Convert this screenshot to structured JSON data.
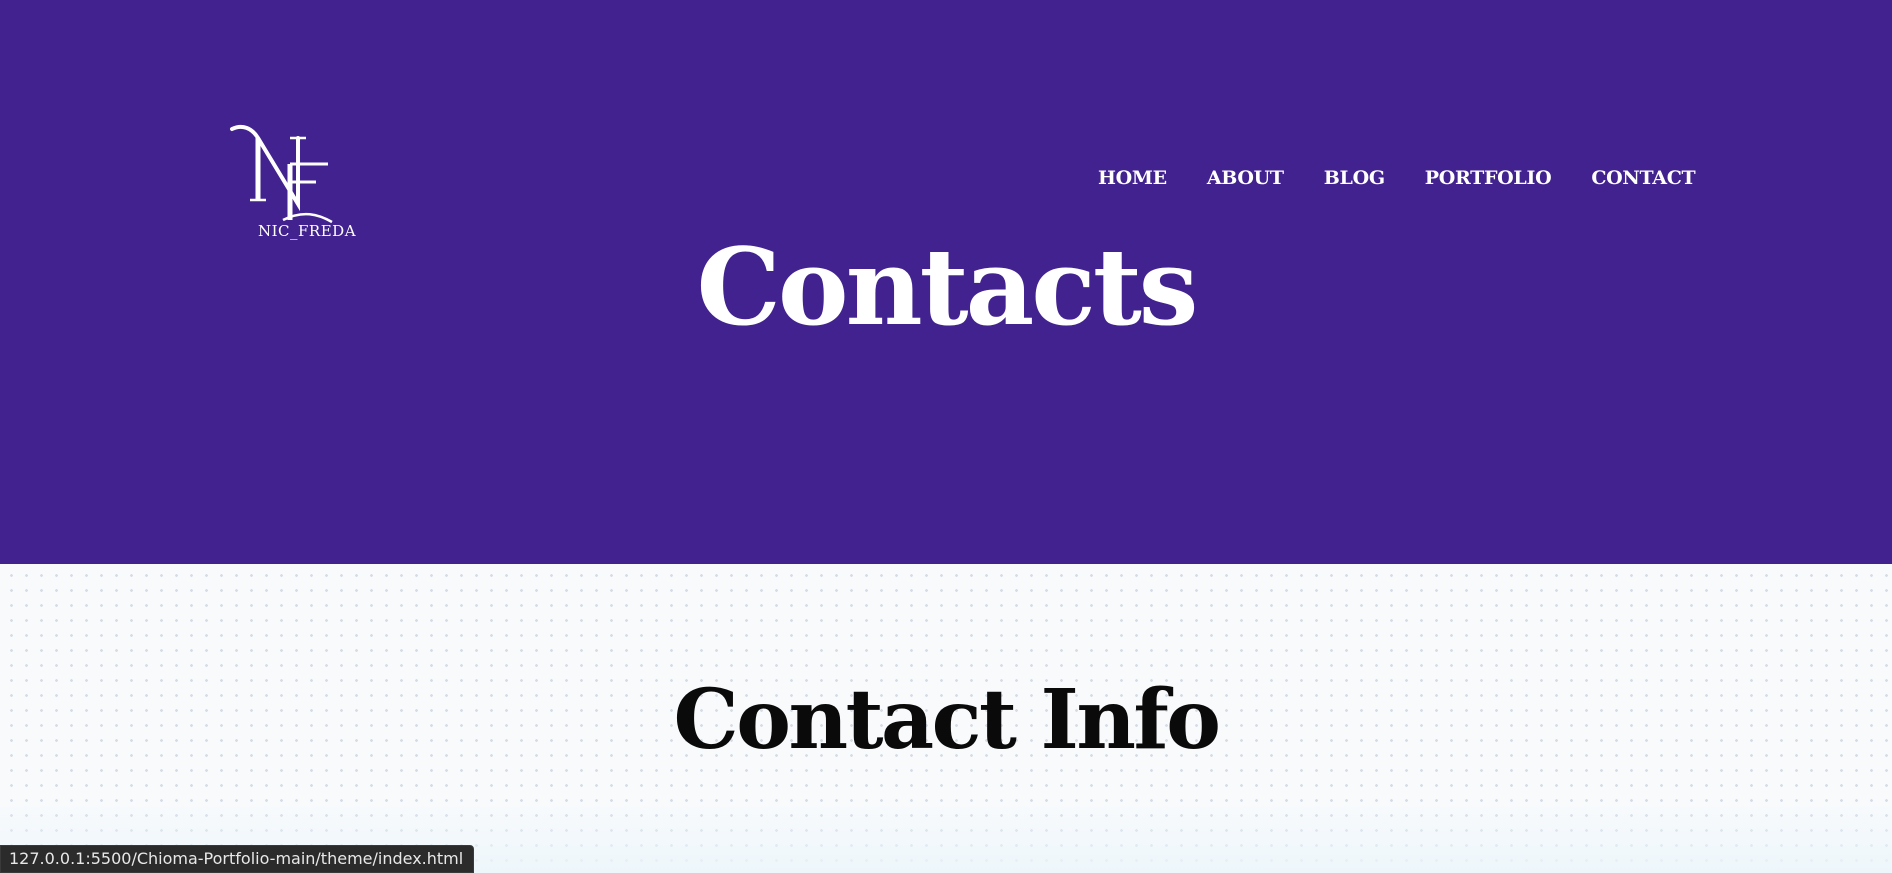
{
  "header": {
    "logo": {
      "monogram": "NF",
      "text": "NIC_FREDA"
    },
    "nav": [
      {
        "label": "HOME"
      },
      {
        "label": "ABOUT"
      },
      {
        "label": "BLOG"
      },
      {
        "label": "PORTFOLIO"
      },
      {
        "label": "CONTACT"
      }
    ]
  },
  "hero": {
    "title": "Contacts"
  },
  "section": {
    "title": "Contact Info"
  },
  "status_bar": {
    "url": "127.0.0.1:5500/Chioma-Portfolio-main/theme/index.html"
  },
  "colors": {
    "hero_background": "#42228f",
    "text_light": "#ffffff",
    "text_dark": "#0a0a0a"
  }
}
